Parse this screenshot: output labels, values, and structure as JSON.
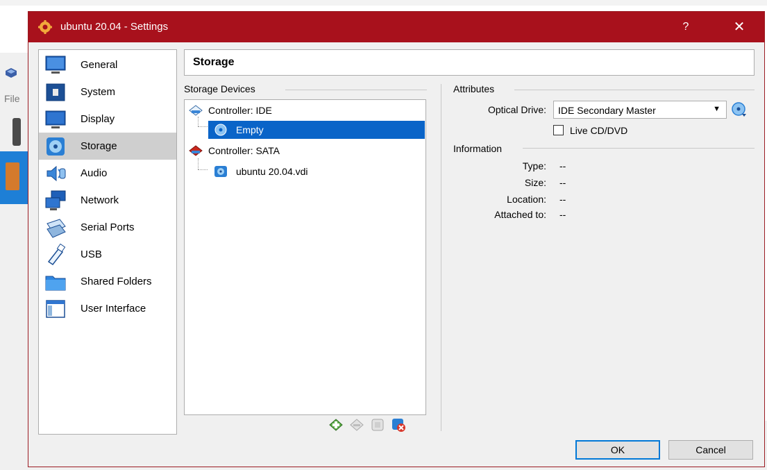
{
  "background_window": {
    "menu_file": "File"
  },
  "dialog": {
    "title": "ubuntu 20.04 - Settings",
    "help_label": "?",
    "close_label": "✕"
  },
  "categories": [
    {
      "label": "General",
      "icon": "general-icon"
    },
    {
      "label": "System",
      "icon": "system-icon"
    },
    {
      "label": "Display",
      "icon": "display-icon"
    },
    {
      "label": "Storage",
      "icon": "storage-icon",
      "selected": true
    },
    {
      "label": "Audio",
      "icon": "audio-icon"
    },
    {
      "label": "Network",
      "icon": "network-icon"
    },
    {
      "label": "Serial Ports",
      "icon": "serial-ports-icon"
    },
    {
      "label": "USB",
      "icon": "usb-icon"
    },
    {
      "label": "Shared Folders",
      "icon": "shared-folders-icon"
    },
    {
      "label": "User Interface",
      "icon": "user-interface-icon"
    }
  ],
  "section": {
    "title": "Storage"
  },
  "storage_devices": {
    "group_title": "Storage Devices",
    "tree": [
      {
        "label": "Controller: IDE",
        "icon": "ide-controller-icon"
      },
      {
        "label": "Empty",
        "icon": "optical-disc-icon",
        "selected": true
      },
      {
        "label": "Controller: SATA",
        "icon": "sata-controller-icon"
      },
      {
        "label": "ubuntu 20.04.vdi",
        "icon": "hard-disk-icon"
      }
    ],
    "toolbar": [
      "add-controller-icon",
      "remove-controller-icon",
      "add-attachment-icon",
      "remove-attachment-icon"
    ]
  },
  "attributes": {
    "group_title": "Attributes",
    "optical_drive_label": "Optical Drive:",
    "optical_drive_value": "IDE Secondary Master",
    "live_cd_label": "Live CD/DVD",
    "live_cd_checked": false
  },
  "information": {
    "group_title": "Information",
    "type_label": "Type:",
    "type_value": "--",
    "size_label": "Size:",
    "size_value": "--",
    "location_label": "Location:",
    "location_value": "--",
    "attached_label": "Attached to:",
    "attached_value": "--"
  },
  "buttons": {
    "ok": "OK",
    "cancel": "Cancel"
  },
  "colors": {
    "titlebar": "#a8111c",
    "selection": "#0a64c8",
    "accent": "#0078d7"
  }
}
